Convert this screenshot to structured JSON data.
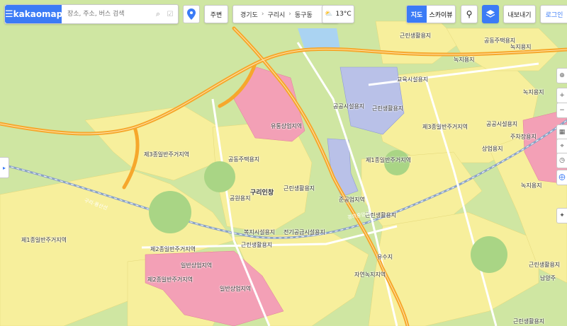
{
  "app": {
    "brand": "kakaomap",
    "search_placeholder": "장소, 주소, 버스 검색"
  },
  "toolbar": {
    "nearby_label": "주변",
    "breadcrumb": [
      "경기도",
      "구리시",
      "동구동"
    ],
    "weather_temp": "13°C",
    "map_type": [
      "지도",
      "스카이뷰"
    ],
    "active_map_type": "지도",
    "export_label": "내보내기",
    "login_label": "로그인"
  },
  "map_labels": {
    "l1": "근린생활용지",
    "l2": "공동주택용지",
    "l3": "녹지용지",
    "l4": "녹지용지",
    "l5": "교육시설용지",
    "l6": "공공시설용지",
    "l7": "근린생활용지",
    "l8": "녹지용지",
    "l9": "유통상업지역",
    "l10": "제3종일반주거지역",
    "l11": "공공시설용지",
    "l12": "제3종일반주거지역",
    "l13": "주차장용지",
    "l14": "상업용지",
    "l15": "공동주택용지",
    "l16": "제1종일반주거지역",
    "l17": "구리인창",
    "l18": "공원용지",
    "l19": "근린생활용지",
    "l20": "녹지용지",
    "l21": "준공업지역",
    "l22": "근린생활용지",
    "l23": "제1종일반주거지역",
    "l24": "복지시설용지",
    "l25": "전기공급시설용지",
    "l26": "근린생활용지",
    "l27": "제2종일반주거지역",
    "l28": "일반상업지역",
    "l29": "제2종일반주거지역",
    "l30": "일반상업지역",
    "l31": "유수지",
    "l32": "자연녹지지역",
    "l33": "근린생활용지",
    "l34": "남양주",
    "l35": "근린생활용지",
    "l36": "구리·용산선",
    "l37": "경의중앙선"
  },
  "colors": {
    "accent": "#3b7bf6",
    "green": "#cfe6a2",
    "yellow": "#f7ef9c",
    "pink": "#f3a0b6",
    "lavender": "#b9c1e8",
    "highway": "#f6a72c"
  }
}
